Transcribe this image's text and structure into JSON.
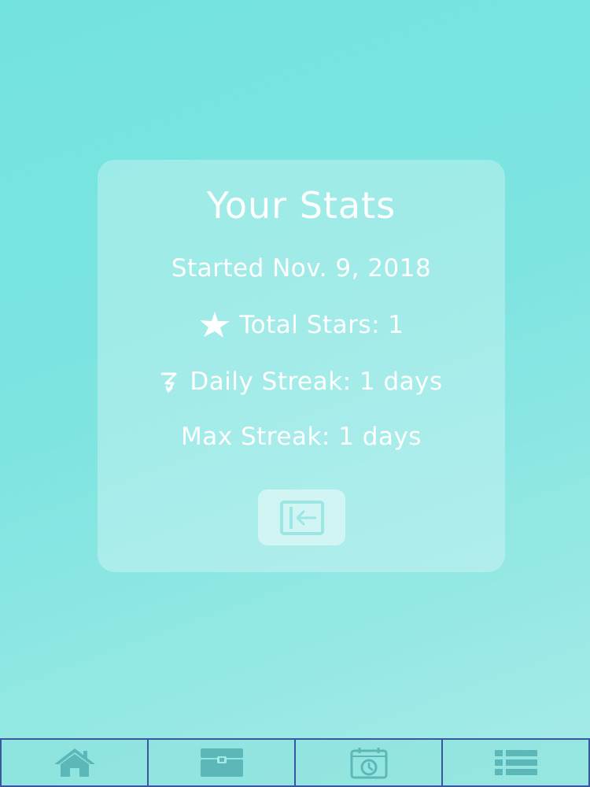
{
  "stats": {
    "title": "Your Stats",
    "started": "Started Nov. 9, 2018",
    "total_stars": "Total Stars: 1",
    "daily_streak": "Daily Streak: 1 days",
    "max_streak": "Max Streak: 1 days",
    "back_icon": "exit-arrow-icon"
  },
  "tabs": [
    {
      "icon": "home-icon"
    },
    {
      "icon": "treasure-chest-icon"
    },
    {
      "icon": "calendar-clock-icon"
    },
    {
      "icon": "list-icon"
    }
  ],
  "colors": {
    "background": "#7ee4e0",
    "text": "#ffffff",
    "tab_border": "#3a58a0",
    "tab_icon": "#5cb8b8"
  }
}
